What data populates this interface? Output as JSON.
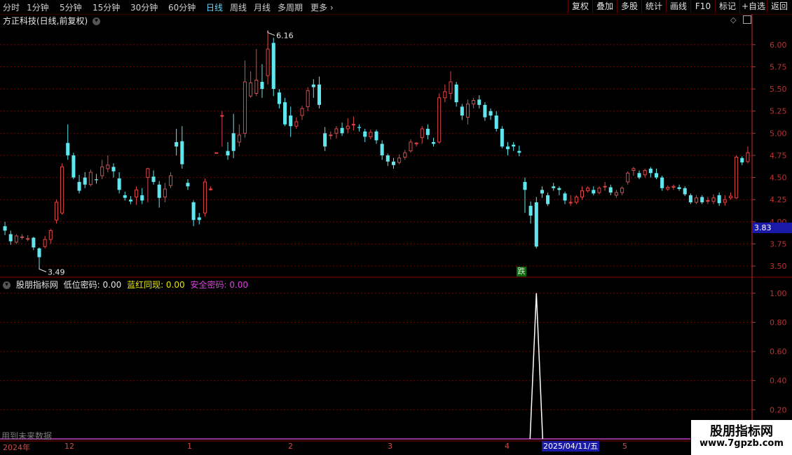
{
  "toolbar": {
    "periods": [
      "分时",
      "1分钟",
      "5分钟",
      "15分钟",
      "30分钟",
      "60分钟",
      "日线",
      "周线",
      "月线",
      "多周期",
      "更多"
    ],
    "active_period": "日线",
    "right_buttons": [
      "复权",
      "叠加",
      "多股",
      "统计",
      "画线",
      "F10",
      "标记",
      "+自选",
      "返回"
    ]
  },
  "stock": {
    "title": "方正科技(日线,前复权)"
  },
  "indicator": {
    "name": "股朋指标网",
    "items": [
      {
        "label": "低位密码: 0.00",
        "color": "#e6e6e6"
      },
      {
        "label": "蓝红同现: 0.00",
        "color": "#e6e600"
      },
      {
        "label": "安全密码: 0.00",
        "color": "#e040e0"
      }
    ],
    "future_note": "用到未来数据"
  },
  "colors": {
    "up": "#e04848",
    "down": "#5fe6ee",
    "grid": "#7a0000",
    "axis": "#c03030"
  },
  "price_axis": {
    "ticks": [
      "6.00",
      "5.75",
      "5.50",
      "5.25",
      "5.00",
      "4.75",
      "4.50",
      "4.25",
      "4.00",
      "3.75",
      "3.50"
    ],
    "current": "3.83",
    "high_label": "6.16",
    "low_label": "3.49"
  },
  "ind_axis": {
    "ticks": [
      "1.00",
      "0.80",
      "0.60",
      "0.40",
      "0.20"
    ]
  },
  "signal": {
    "label": "跌"
  },
  "date_axis": {
    "labels": [
      "2024年",
      "12",
      "1",
      "2",
      "3",
      "4",
      "5"
    ],
    "selected": "2025/04/11/五"
  },
  "watermark": {
    "line1": "股朋指标网",
    "line2": "www.7gpzb.com"
  },
  "chart_data": {
    "type": "candlestick",
    "price_range": [
      3.39,
      6.22
    ],
    "candles": [
      [
        3.95,
        3.9,
        4.0,
        3.85
      ],
      [
        3.86,
        3.78,
        3.9,
        3.74
      ],
      [
        3.77,
        3.84,
        3.86,
        3.75
      ],
      [
        3.83,
        3.83,
        3.86,
        3.8
      ],
      [
        3.81,
        3.81,
        3.85,
        3.78
      ],
      [
        3.82,
        3.71,
        3.83,
        3.68
      ],
      [
        3.7,
        3.6,
        3.71,
        3.49
      ],
      [
        3.72,
        3.8,
        3.84,
        3.7
      ],
      [
        3.8,
        3.9,
        3.92,
        3.75
      ],
      [
        4.02,
        4.22,
        4.25,
        3.98
      ],
      [
        4.1,
        4.62,
        4.66,
        4.08
      ],
      [
        4.89,
        4.75,
        5.1,
        4.7
      ],
      [
        4.75,
        4.5,
        4.78,
        4.48
      ],
      [
        4.45,
        4.35,
        4.53,
        4.32
      ],
      [
        4.5,
        4.42,
        4.56,
        4.38
      ],
      [
        4.42,
        4.56,
        4.59,
        4.4
      ],
      [
        4.48,
        4.47,
        4.54,
        4.43
      ],
      [
        4.52,
        4.62,
        4.7,
        4.48
      ],
      [
        4.6,
        4.64,
        4.75,
        4.56
      ],
      [
        4.62,
        4.57,
        4.66,
        4.5
      ],
      [
        4.49,
        4.36,
        4.56,
        4.32
      ],
      [
        4.3,
        4.27,
        4.34,
        4.24
      ],
      [
        4.25,
        4.23,
        4.29,
        4.2
      ],
      [
        4.28,
        4.36,
        4.4,
        4.19
      ],
      [
        4.3,
        4.24,
        4.38,
        4.2
      ],
      [
        4.5,
        4.6,
        4.61,
        4.22
      ],
      [
        4.51,
        4.45,
        4.58,
        4.42
      ],
      [
        4.42,
        4.27,
        4.46,
        4.16
      ],
      [
        4.28,
        4.37,
        4.44,
        4.22
      ],
      [
        4.41,
        4.52,
        4.56,
        4.38
      ],
      [
        4.9,
        4.85,
        5.05,
        4.75
      ],
      [
        4.91,
        4.65,
        5.08,
        4.6
      ],
      [
        4.44,
        4.4,
        4.48,
        4.36
      ],
      [
        4.22,
        4.02,
        4.24,
        3.95
      ],
      [
        4.05,
        4.02,
        4.1,
        3.97
      ],
      [
        4.1,
        4.45,
        4.49,
        4.06
      ],
      [
        4.37,
        4.37,
        4.4,
        4.35
      ],
      [
        4.78,
        4.78,
        4.78,
        4.78
      ],
      [
        5.2,
        5.2,
        5.25,
        4.85
      ],
      [
        4.8,
        4.75,
        4.9,
        4.7
      ],
      [
        5.0,
        4.8,
        5.22,
        4.72
      ],
      [
        4.9,
        4.98,
        5.1,
        4.85
      ],
      [
        5.0,
        5.58,
        5.82,
        4.95
      ],
      [
        5.42,
        5.57,
        5.7,
        5.4
      ],
      [
        5.45,
        5.6,
        5.95,
        5.42
      ],
      [
        5.58,
        5.5,
        5.78,
        5.4
      ],
      [
        5.65,
        5.95,
        6.16,
        5.55
      ],
      [
        6.02,
        5.5,
        6.08,
        5.42
      ],
      [
        5.46,
        5.33,
        5.5,
        5.28
      ],
      [
        5.35,
        5.1,
        5.4,
        5.08
      ],
      [
        5.2,
        5.08,
        5.3,
        4.96
      ],
      [
        5.08,
        5.13,
        5.18,
        5.05
      ],
      [
        5.2,
        5.28,
        5.31,
        5.15
      ],
      [
        5.3,
        5.48,
        5.52,
        5.25
      ],
      [
        5.55,
        5.52,
        5.61,
        5.4
      ],
      [
        5.55,
        5.32,
        5.64,
        5.28
      ],
      [
        5.0,
        4.85,
        5.07,
        4.8
      ],
      [
        4.98,
        4.98,
        5.02,
        4.93
      ],
      [
        5.0,
        5.05,
        5.08,
        4.94
      ],
      [
        5.06,
        5.0,
        5.12,
        4.97
      ],
      [
        5.05,
        5.08,
        5.17,
        5.0
      ],
      [
        5.1,
        5.1,
        5.19,
        5.03
      ],
      [
        5.07,
        5.06,
        5.1,
        5.02
      ],
      [
        5.02,
        4.96,
        5.05,
        4.9
      ],
      [
        4.96,
        5.01,
        5.04,
        4.93
      ],
      [
        5.02,
        4.92,
        5.04,
        4.88
      ],
      [
        4.88,
        4.75,
        4.92,
        4.7
      ],
      [
        4.75,
        4.68,
        4.77,
        4.63
      ],
      [
        4.68,
        4.64,
        4.72,
        4.6
      ],
      [
        4.67,
        4.72,
        4.76,
        4.65
      ],
      [
        4.73,
        4.78,
        4.81,
        4.7
      ],
      [
        4.8,
        4.9,
        4.93,
        4.78
      ],
      [
        4.88,
        4.89,
        4.9,
        4.85
      ],
      [
        4.95,
        5.05,
        5.08,
        4.88
      ],
      [
        5.05,
        4.98,
        5.1,
        4.93
      ],
      [
        4.9,
        4.88,
        4.95,
        4.85
      ],
      [
        4.9,
        5.4,
        5.45,
        4.88
      ],
      [
        5.4,
        5.47,
        5.55,
        5.35
      ],
      [
        5.45,
        5.58,
        5.7,
        5.38
      ],
      [
        5.55,
        5.35,
        5.58,
        5.3
      ],
      [
        5.3,
        5.2,
        5.33,
        5.15
      ],
      [
        5.18,
        5.33,
        5.38,
        5.1
      ],
      [
        5.33,
        5.37,
        5.4,
        5.28
      ],
      [
        5.38,
        5.32,
        5.43,
        5.28
      ],
      [
        5.32,
        5.18,
        5.35,
        5.14
      ],
      [
        5.25,
        5.2,
        5.28,
        5.15
      ],
      [
        5.2,
        5.05,
        5.25,
        5.02
      ],
      [
        5.05,
        4.85,
        5.08,
        4.83
      ],
      [
        4.85,
        4.82,
        4.9,
        4.75
      ],
      [
        4.87,
        4.85,
        4.9,
        4.8
      ],
      [
        4.8,
        4.78,
        4.86,
        4.74
      ],
      [
        4.45,
        4.36,
        4.5,
        4.1
      ],
      [
        4.18,
        4.07,
        4.23,
        3.98
      ],
      [
        4.22,
        3.72,
        4.28,
        3.7
      ],
      [
        4.36,
        4.32,
        4.4,
        4.27
      ],
      [
        4.3,
        4.2,
        4.33,
        4.18
      ],
      [
        4.4,
        4.38,
        4.44,
        4.35
      ],
      [
        4.38,
        4.36,
        4.4,
        4.3
      ],
      [
        4.32,
        4.24,
        4.34,
        4.2
      ],
      [
        4.22,
        4.22,
        4.3,
        4.18
      ],
      [
        4.22,
        4.28,
        4.3,
        4.2
      ],
      [
        4.28,
        4.35,
        4.4,
        4.25
      ],
      [
        4.35,
        4.38,
        4.4,
        4.33
      ],
      [
        4.36,
        4.32,
        4.4,
        4.3
      ],
      [
        4.33,
        4.38,
        4.4,
        4.31
      ],
      [
        4.4,
        4.4,
        4.45,
        4.35
      ],
      [
        4.39,
        4.33,
        4.42,
        4.3
      ],
      [
        4.3,
        4.33,
        4.36,
        4.27
      ],
      [
        4.33,
        4.38,
        4.4,
        4.3
      ],
      [
        4.45,
        4.55,
        4.57,
        4.42
      ],
      [
        4.58,
        4.6,
        4.62,
        4.52
      ],
      [
        4.55,
        4.5,
        4.58,
        4.48
      ],
      [
        4.53,
        4.58,
        4.6,
        4.5
      ],
      [
        4.6,
        4.55,
        4.62,
        4.5
      ],
      [
        4.55,
        4.5,
        4.6,
        4.48
      ],
      [
        4.5,
        4.38,
        4.52,
        4.35
      ],
      [
        4.37,
        4.39,
        4.41,
        4.35
      ],
      [
        4.39,
        4.4,
        4.42,
        4.36
      ],
      [
        4.39,
        4.37,
        4.42,
        4.35
      ],
      [
        4.38,
        4.31,
        4.4,
        4.29
      ],
      [
        4.3,
        4.22,
        4.32,
        4.2
      ],
      [
        4.22,
        4.27,
        4.3,
        4.2
      ],
      [
        4.28,
        4.22,
        4.3,
        4.2
      ],
      [
        4.24,
        4.24,
        4.28,
        4.2
      ],
      [
        4.23,
        4.27,
        4.31,
        4.2
      ],
      [
        4.3,
        4.21,
        4.33,
        4.18
      ],
      [
        4.22,
        4.25,
        4.3,
        4.18
      ],
      [
        4.27,
        4.29,
        4.33,
        4.25
      ],
      [
        4.27,
        4.73,
        4.75,
        4.26
      ],
      [
        4.72,
        4.67,
        4.74,
        4.64
      ],
      [
        4.68,
        4.78,
        4.85,
        4.66
      ]
    ],
    "indicator_range": [
      0,
      1.1
    ],
    "indicator_spike": {
      "candle_index": 93,
      "value": 1.0
    }
  }
}
